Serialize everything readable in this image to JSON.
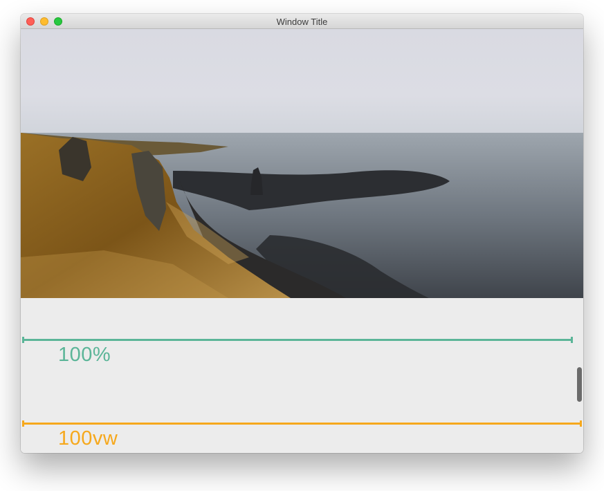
{
  "window": {
    "title": "Window Title"
  },
  "image": {
    "subject": "coastal-landscape-photo"
  },
  "measures": [
    {
      "label": "100%",
      "color": "#5bb598"
    },
    {
      "label": "100vw",
      "color": "#f6a81c"
    }
  ],
  "colors": {
    "window_background": "#ececec",
    "titlebar": "#dcdcdc",
    "scrollbar_thumb": "#6b6b6b"
  }
}
